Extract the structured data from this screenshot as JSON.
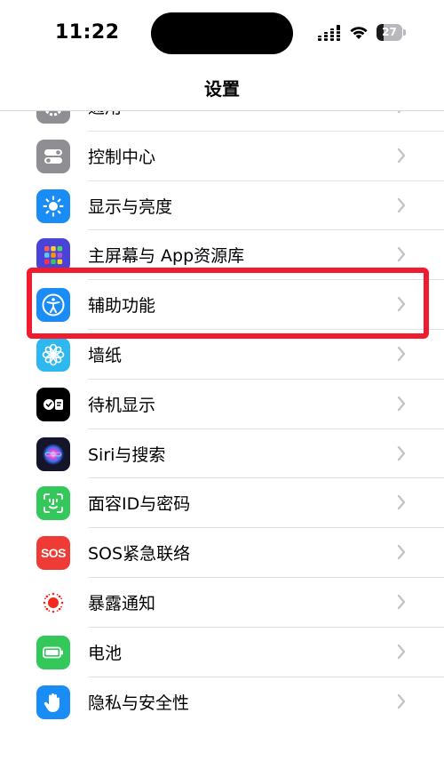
{
  "status_bar": {
    "time": "11:22",
    "battery_level": 27,
    "battery_text": "27"
  },
  "nav": {
    "title": "设置"
  },
  "list": {
    "items": [
      {
        "label": "通用",
        "icon": "gear-icon",
        "color": "#8e8e93"
      },
      {
        "label": "控制中心",
        "icon": "toggle-icon",
        "color": "#8e8e93"
      },
      {
        "label": "显示与亮度",
        "icon": "sun-icon",
        "color": "#1a8cf5"
      },
      {
        "label": "主屏幕与 App资源库",
        "icon": "app-grid-icon",
        "color": "#5b4bd6"
      },
      {
        "label": "辅助功能",
        "icon": "accessibility-icon",
        "color": "#1a8cf5"
      },
      {
        "label": "墙纸",
        "icon": "flower-icon",
        "color": "#2fb8f0"
      },
      {
        "label": "待机显示",
        "icon": "standby-icon",
        "color": "#000000"
      },
      {
        "label": "Siri与搜索",
        "icon": "siri-icon",
        "color": "#1c1c2e"
      },
      {
        "label": "面容ID与密码",
        "icon": "face-id-icon",
        "color": "#34c759"
      },
      {
        "label": "SOS紧急联络",
        "icon": "sos-icon",
        "color": "#ef3b36",
        "badge": "SOS"
      },
      {
        "label": "暴露通知",
        "icon": "exposure-icon",
        "color": "#ffffff"
      },
      {
        "label": "电池",
        "icon": "battery-icon",
        "color": "#34c759"
      },
      {
        "label": "隐私与安全性",
        "icon": "hand-icon",
        "color": "#1a8cf5"
      }
    ]
  },
  "highlight_target": "辅助功能",
  "colors": {
    "highlight": "#f21b2d",
    "chevron": "#c4c4c7",
    "separator": "#e2e2e6"
  }
}
